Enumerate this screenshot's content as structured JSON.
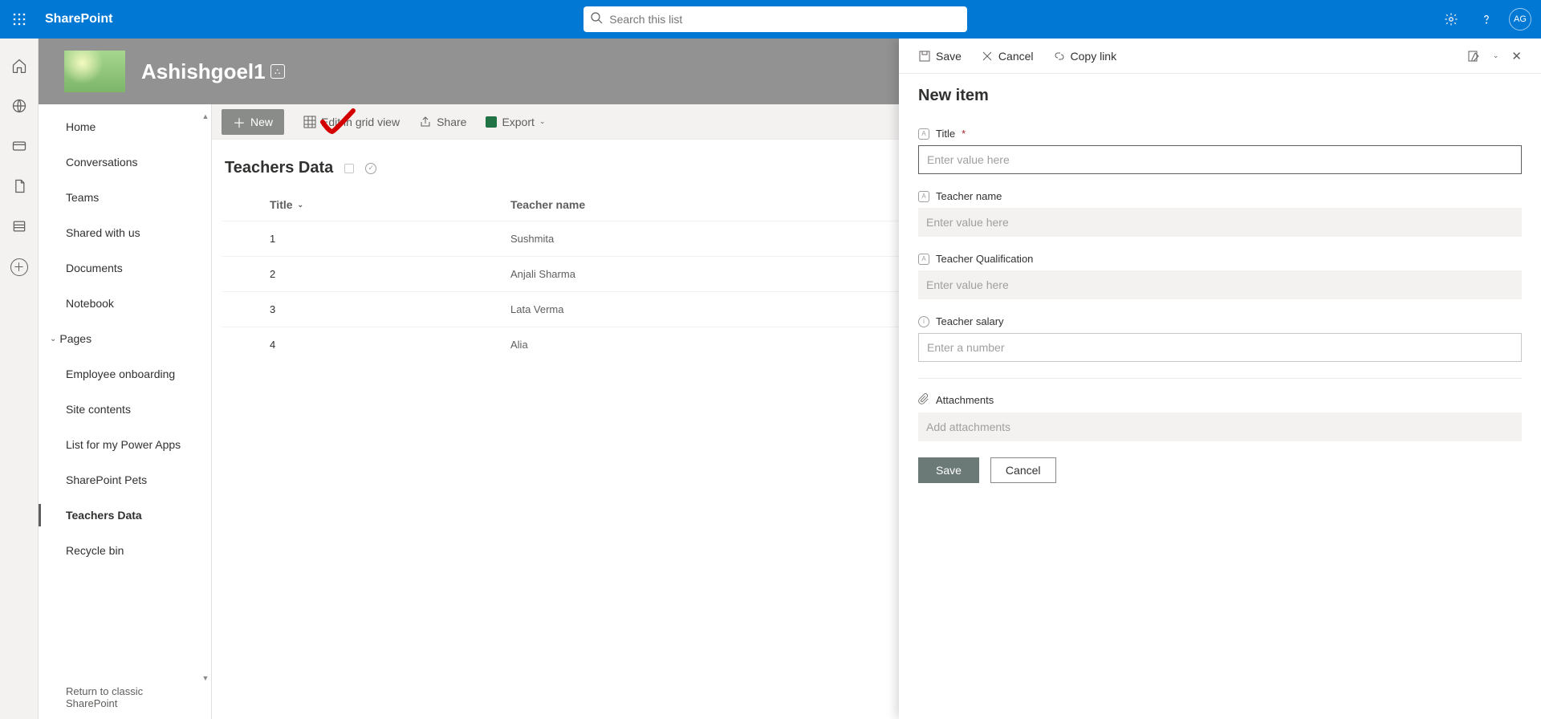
{
  "header": {
    "app_name": "SharePoint",
    "search_placeholder": "Search this list",
    "avatar_initials": "AG"
  },
  "site": {
    "name": "Ashishgoel1"
  },
  "nav": {
    "items": [
      "Home",
      "Conversations",
      "Teams",
      "Shared with us",
      "Documents",
      "Notebook"
    ],
    "pages_parent": "Pages",
    "pages_children": [
      "Employee onboarding",
      "Site contents",
      "List for my Power Apps",
      "SharePoint Pets",
      "Teachers Data",
      "Recycle bin"
    ],
    "active": "Teachers Data",
    "classic_link": "Return to classic SharePoint"
  },
  "cmdbar": {
    "new": "New",
    "edit_grid": "Edit in grid view",
    "share": "Share",
    "export": "Export"
  },
  "list": {
    "title": "Teachers Data",
    "columns": {
      "title": "Title",
      "teacher_name": "Teacher name"
    },
    "rows": [
      {
        "title": "1",
        "teacher_name": "Sushmita"
      },
      {
        "title": "2",
        "teacher_name": "Anjali Sharma"
      },
      {
        "title": "3",
        "teacher_name": "Lata Verma"
      },
      {
        "title": "4",
        "teacher_name": "Alia"
      }
    ]
  },
  "panel": {
    "cmd_save": "Save",
    "cmd_cancel": "Cancel",
    "cmd_copy": "Copy link",
    "title": "New item",
    "fields": {
      "title_label": "Title",
      "title_placeholder": "Enter value here",
      "name_label": "Teacher name",
      "name_placeholder": "Enter value here",
      "qual_label": "Teacher Qualification",
      "qual_placeholder": "Enter value here",
      "salary_label": "Teacher salary",
      "salary_placeholder": "Enter a number",
      "attach_label": "Attachments",
      "attach_action": "Add attachments"
    },
    "btn_save": "Save",
    "btn_cancel": "Cancel"
  }
}
